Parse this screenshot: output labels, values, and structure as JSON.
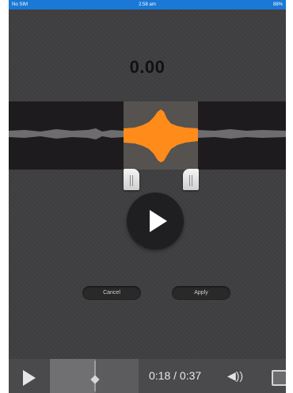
{
  "statusbar": {
    "carrier": "No SIM",
    "time": "2:58 am",
    "battery": "88%"
  },
  "editor": {
    "time_readout": "0.00"
  },
  "buttons": {
    "cancel_label": "Cancel",
    "apply_label": "Apply"
  },
  "player": {
    "current_time": "0:18",
    "separator": "/",
    "duration": "0:37",
    "progress": 0.49
  },
  "colors": {
    "waveform_selected": "#ff8c1a",
    "waveform_unselected": "#6d6c6e",
    "status_bar": "#1a78d6"
  },
  "icons": {
    "big_play": "play-icon",
    "player_play": "play-icon",
    "volume": "volume-icon",
    "screen": "airplay-icon"
  }
}
